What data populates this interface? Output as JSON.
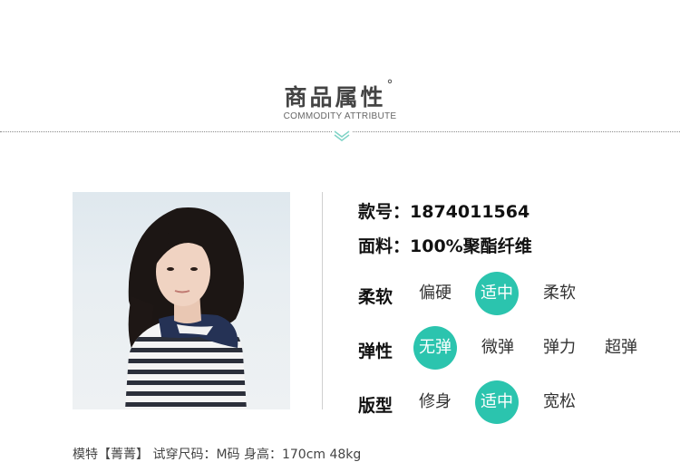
{
  "header": {
    "title": "商品属性",
    "title_mark": "°",
    "subtitle": "COMMODITY ATTRIBUTE"
  },
  "colors": {
    "accent": "#2bc4ae"
  },
  "product": {
    "style_no": "款号：1874011564",
    "material": "面料：100%聚酯纤维"
  },
  "attributes": [
    {
      "label": "柔软",
      "options": [
        "偏硬",
        "适中",
        "柔软"
      ],
      "selected": "适中"
    },
    {
      "label": "弹性",
      "options": [
        "无弹",
        "微弹",
        "弹力",
        "超弹"
      ],
      "selected": "无弹"
    },
    {
      "label": "版型",
      "options": [
        "修身",
        "适中",
        "宽松"
      ],
      "selected": "适中"
    }
  ],
  "model_info": "模特【菁菁】 试穿尺码：M码 身高：170cm 48kg"
}
